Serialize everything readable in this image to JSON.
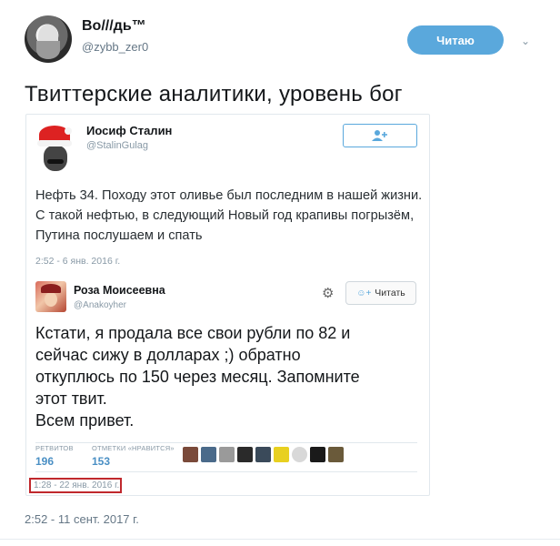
{
  "author": {
    "display_name": "Во///дь™",
    "handle": "@zybb_zer0",
    "follow_label": "Читаю"
  },
  "tweet": {
    "text": "Твиттерские аналитики, уровень бог",
    "timestamp": "2:52 - 11 сент. 2017 г."
  },
  "embedded_stalin": {
    "name": "Иосиф Сталин",
    "handle": "@StalinGulag",
    "follow_icon": "add-user-icon",
    "text": "Нефть 34. Походу этот оливье был последним в нашей жизни. С такой нефтью, в следующий Новый год крапивы погрызём, Путина послушаем и спать",
    "date": "2:52 - 6 янв. 2016 г."
  },
  "embedded_roza": {
    "name": "Роза Моисеевна",
    "handle": "@Anakoyher",
    "follow_label": "Читать",
    "text_lines": [
      "Кстати, я продала все свои рубли по 82 и",
      "сейчас сижу в долларах ;) обратно",
      "откуплюсь по 150 через месяц. Запомните",
      "этот твит.",
      "Всем привет."
    ],
    "retweets_label": "РЕТВИТОВ",
    "retweets": "196",
    "likes_label": "ОТМЕТКИ «НРАВИТСЯ»",
    "likes": "153",
    "date": "1:28 - 22 янв. 2016 г."
  },
  "colors": {
    "accent": "#5aa8dc",
    "highlight_box": "#c0282d"
  }
}
